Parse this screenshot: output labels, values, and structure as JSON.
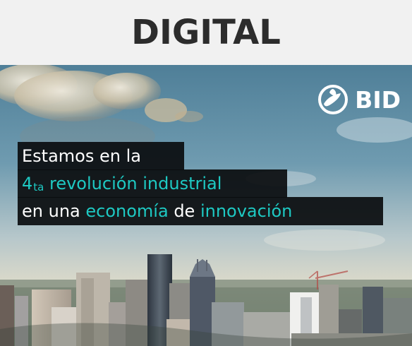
{
  "header": {
    "title": "DIGITAL"
  },
  "hero": {
    "logo_text": "BID",
    "message": {
      "line1": "Estamos en la",
      "line2_part1": "4",
      "line2_part2": "ta",
      "line2_part3": "revolución industrial",
      "line3_part1": "en una",
      "line3_part2": "economía",
      "line3_part3": "de",
      "line3_part4": "innovación"
    }
  },
  "colors": {
    "header_bg": "#f1f1f1",
    "header_text": "#2c2c2c",
    "overlay_bg": "#0a0c0e",
    "accent": "#1ec9c3",
    "overlay_text": "#ffffff"
  },
  "icons": {
    "logo": "globe-hand-icon"
  }
}
